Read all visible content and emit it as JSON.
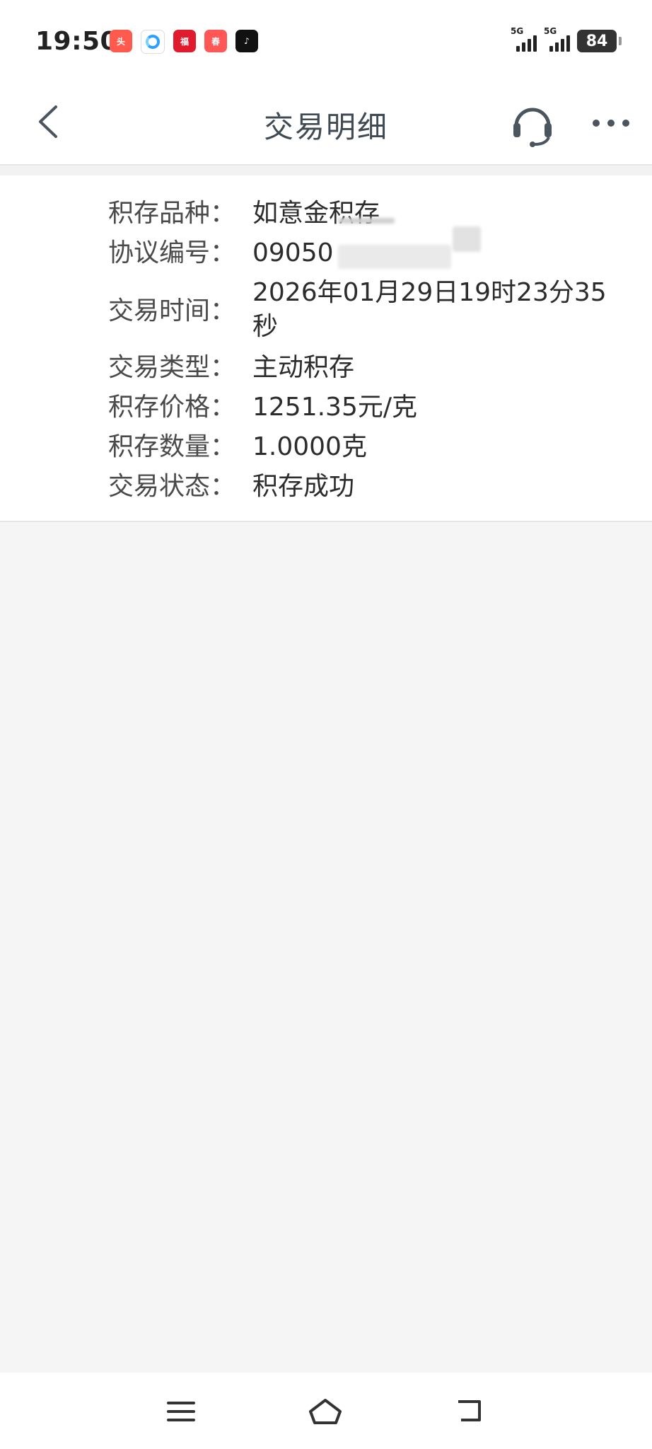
{
  "status_bar": {
    "time": "19:50",
    "network_1": "5G",
    "network_2": "5G",
    "battery": "84"
  },
  "header": {
    "title": "交易明细",
    "back_icon": "chevron-left-icon",
    "service_icon": "headset-icon",
    "more_icon": "more-dots-icon"
  },
  "details": [
    {
      "label": "积存品种：",
      "value": "如意金积存"
    },
    {
      "label": "协议编号：",
      "value": "09050"
    },
    {
      "label": "交易时间：",
      "value": "2026年01月29日19时23分35秒"
    },
    {
      "label": "交易类型：",
      "value": "主动积存"
    },
    {
      "label": "积存价格：",
      "value": "1251.35元/克"
    },
    {
      "label": "积存数量：",
      "value": "1.0000克"
    },
    {
      "label": "交易状态：",
      "value": "积存成功"
    }
  ],
  "nav": {
    "menu_icon": "menu-icon",
    "home_icon": "home-icon",
    "back_icon": "back-arrow-icon"
  },
  "colors": {
    "background": "#f5f5f5",
    "card": "#ffffff",
    "title": "#3f4a52",
    "text": "#2c2c2c"
  }
}
